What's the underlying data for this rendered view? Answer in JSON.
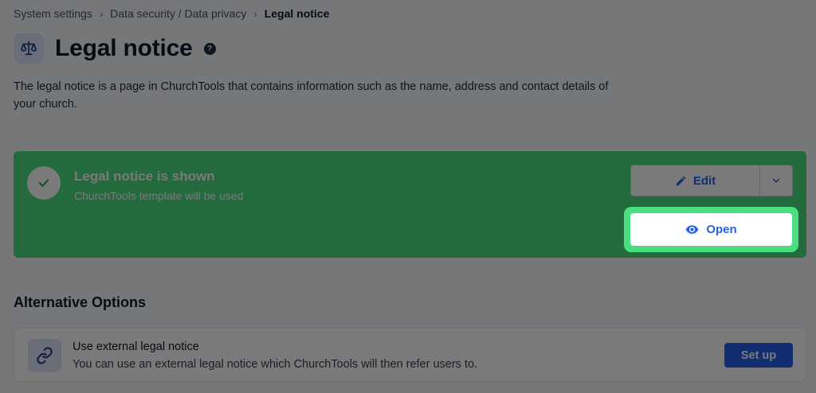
{
  "breadcrumb": {
    "items": [
      "System settings",
      "Data security / Data privacy",
      "Legal notice"
    ],
    "separator": "›"
  },
  "header": {
    "title": "Legal notice",
    "icon": "scale-icon",
    "help_label": "?"
  },
  "description": "The legal notice is a page in ChurchTools that contains information such as the name, address and contact details of your church.",
  "status": {
    "title": "Legal notice is shown",
    "subtitle": "ChurchTools template will be used",
    "edit_label": "Edit",
    "open_label": "Open",
    "color": "#4ade80"
  },
  "alternatives": {
    "heading": "Alternative Options",
    "items": [
      {
        "title": "Use external legal notice",
        "subtitle": "You can use an external legal notice which ChurchTools will then refer users to.",
        "button_label": "Set up",
        "icon": "link-icon"
      }
    ]
  },
  "colors": {
    "accent": "#2563eb",
    "success": "#4ade80",
    "overlay": "rgba(0,0,0,0.52)"
  }
}
